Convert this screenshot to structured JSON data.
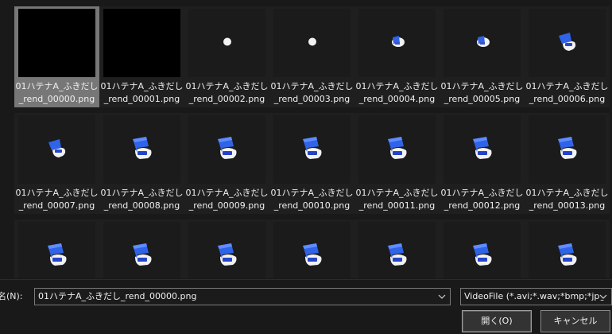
{
  "files": [
    {
      "name": "01ハテナA_ふきだし\n_rend_00000.png",
      "thumb": "black"
    },
    {
      "name": "01ハテナA_ふきだし\n_rend_00001.png",
      "thumb": "black"
    },
    {
      "name": "01ハテナA_ふきだし\n_rend_00002.png",
      "thumb": "dot"
    },
    {
      "name": "01ハテナA_ふきだし\n_rend_00003.png",
      "thumb": "dot"
    },
    {
      "name": "01ハテナA_ふきだし\n_rend_00004.png",
      "thumb": "small"
    },
    {
      "name": "01ハテナA_ふきだし\n_rend_00005.png",
      "thumb": "small"
    },
    {
      "name": "01ハテナA_ふきだし\n_rend_00006.png",
      "thumb": "mid"
    },
    {
      "name": "01ハテナA_ふきだし\n_rend_00007.png",
      "thumb": "mid"
    },
    {
      "name": "01ハテナA_ふきだし\n_rend_00008.png",
      "thumb": "full"
    },
    {
      "name": "01ハテナA_ふきだし\n_rend_00009.png",
      "thumb": "full"
    },
    {
      "name": "01ハテナA_ふきだし\n_rend_00010.png",
      "thumb": "full"
    },
    {
      "name": "01ハテナA_ふきだし\n_rend_00011.png",
      "thumb": "full"
    },
    {
      "name": "01ハテナA_ふきだし\n_rend_00012.png",
      "thumb": "full"
    },
    {
      "name": "01ハテナA_ふきだし\n_rend_00013.png",
      "thumb": "full"
    },
    {
      "name": "",
      "thumb": "full"
    },
    {
      "name": "",
      "thumb": "full"
    },
    {
      "name": "",
      "thumb": "full"
    },
    {
      "name": "",
      "thumb": "full"
    },
    {
      "name": "",
      "thumb": "full"
    },
    {
      "name": "",
      "thumb": "full"
    },
    {
      "name": "",
      "thumb": "full"
    }
  ],
  "selected_index": 0,
  "filename": {
    "label": "ル名(N):",
    "value": "01ハテナA_ふきだし_rend_00000.png"
  },
  "filetype": {
    "value": "VideoFile (*.avi;*.wav;*bmp;*jpg"
  },
  "buttons": {
    "open": "開く(O)",
    "cancel": "キャンセル"
  },
  "colors": {
    "icon_blue": "#2f63e8",
    "icon_white": "#f2f2f2",
    "selected_bg": "#777777"
  }
}
